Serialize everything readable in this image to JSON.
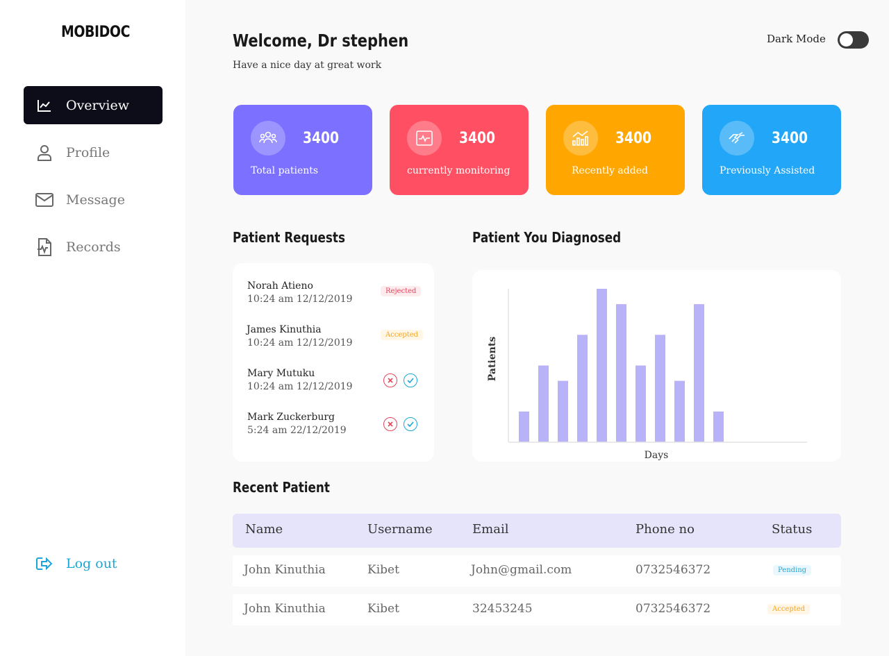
{
  "sidebar": {
    "logo": "MOBIDOC",
    "items": [
      {
        "label": "Overview",
        "icon": "chart-line-icon",
        "active": true
      },
      {
        "label": "Profile",
        "icon": "user-icon",
        "active": false
      },
      {
        "label": "Message",
        "icon": "envelope-icon",
        "active": false
      },
      {
        "label": "Records",
        "icon": "file-pulse-icon",
        "active": false
      }
    ],
    "logout": "Log out"
  },
  "header": {
    "title": "Welcome, Dr stephen",
    "subtitle": "Have a nice day at great work",
    "dark_mode_label": "Dark Mode",
    "dark_mode_on": false
  },
  "stats": [
    {
      "value": "3400",
      "label": "Total patients",
      "color": "#7b70ff",
      "icon": "users-icon"
    },
    {
      "value": "3400",
      "label": "currently monitoring",
      "color": "#ff5063",
      "icon": "monitor-pulse-icon"
    },
    {
      "value": "3400",
      "label": "Recently added",
      "color": "#ffa700",
      "icon": "chart-bars-icon"
    },
    {
      "value": "3400",
      "label": "Previously Assisted",
      "color": "#22a6f7",
      "icon": "handshake-icon"
    }
  ],
  "requests": {
    "title": "Patient Requests",
    "items": [
      {
        "name": "Norah Atieno",
        "time": "10:24 am 12/12/2019",
        "status": "Rejected"
      },
      {
        "name": "James Kinuthia",
        "time": "10:24 am 12/12/2019",
        "status": "Accepted"
      },
      {
        "name": "Mary Mutuku",
        "time": "10:24 am 12/12/2019",
        "status": ""
      },
      {
        "name": "Mark Zuckerburg",
        "time": "5:24 am 22/12/2019",
        "status": ""
      }
    ]
  },
  "diagnosed": {
    "title": "Patient You Diagnosed"
  },
  "chart_data": {
    "type": "bar",
    "title": "Patient You Diagnosed",
    "xlabel": "Days",
    "ylabel": "Patients",
    "values": [
      2,
      5,
      4,
      7,
      10,
      9,
      5,
      7,
      4,
      9,
      2
    ],
    "ylim": [
      0,
      10
    ],
    "color": "#b8b3f8",
    "grid": false
  },
  "recent": {
    "title": "Recent Patient",
    "columns": [
      "Name",
      "Username",
      "Email",
      "Phone no",
      "Status"
    ],
    "rows": [
      {
        "name": "John Kinuthia",
        "username": "Kibet",
        "email": "John@gmail.com",
        "phone": "0732546372",
        "status": "Pending"
      },
      {
        "name": "John Kinuthia",
        "username": "Kibet",
        "email": "32453245",
        "phone": "0732546372",
        "status": "Accepted"
      }
    ]
  }
}
